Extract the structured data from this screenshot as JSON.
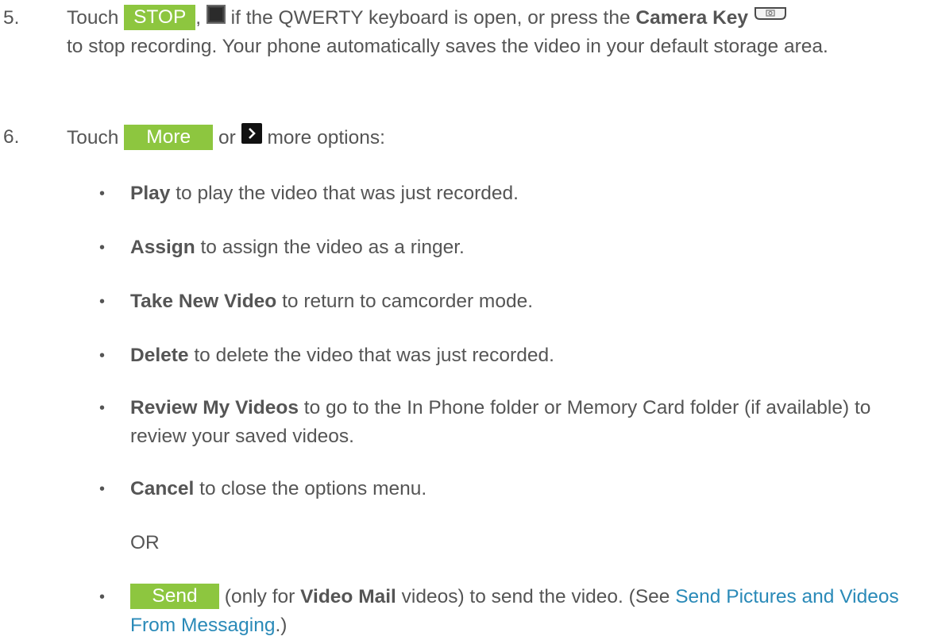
{
  "step5": {
    "number": "5.",
    "t1": "Touch",
    "stop_button": "STOP",
    "t2": ",",
    "t3": " if the QWERTY keyboard is open, or press the ",
    "camera_key": "Camera Key",
    "t4": "to stop recording. Your phone automatically saves the video in your default storage area."
  },
  "step6": {
    "number": "6.",
    "t1": "Touch",
    "more_button": "More",
    "t2": "or",
    "t3": "more options:"
  },
  "options": [
    {
      "bold": "Play",
      "text": " to play the video that was just recorded."
    },
    {
      "bold": "Assign",
      "text": " to assign the video as a ringer."
    },
    {
      "bold": "Take New Video",
      "text": " to return to camcorder mode."
    },
    {
      "bold": "Delete",
      "text": " to delete the video that was just recorded."
    },
    {
      "bold": "Review My Videos",
      "text": " to go to the In Phone folder or Memory Card folder (if available) to review your saved videos."
    },
    {
      "bold": "Cancel",
      "text": " to close the options menu."
    }
  ],
  "or_text": "OR",
  "send": {
    "button": "Send",
    "t1": " (only for ",
    "bold": "Video Mail",
    "t2": " videos) to send the video. (See ",
    "link": "Send Pictures and Videos From Messaging",
    "t3": ".)"
  },
  "colors": {
    "softkey": "#8dc63f",
    "link": "#2a8ab8",
    "text": "#555555"
  },
  "icons": [
    "stop-square-icon",
    "chevron-right-icon",
    "camera-key-icon"
  ]
}
